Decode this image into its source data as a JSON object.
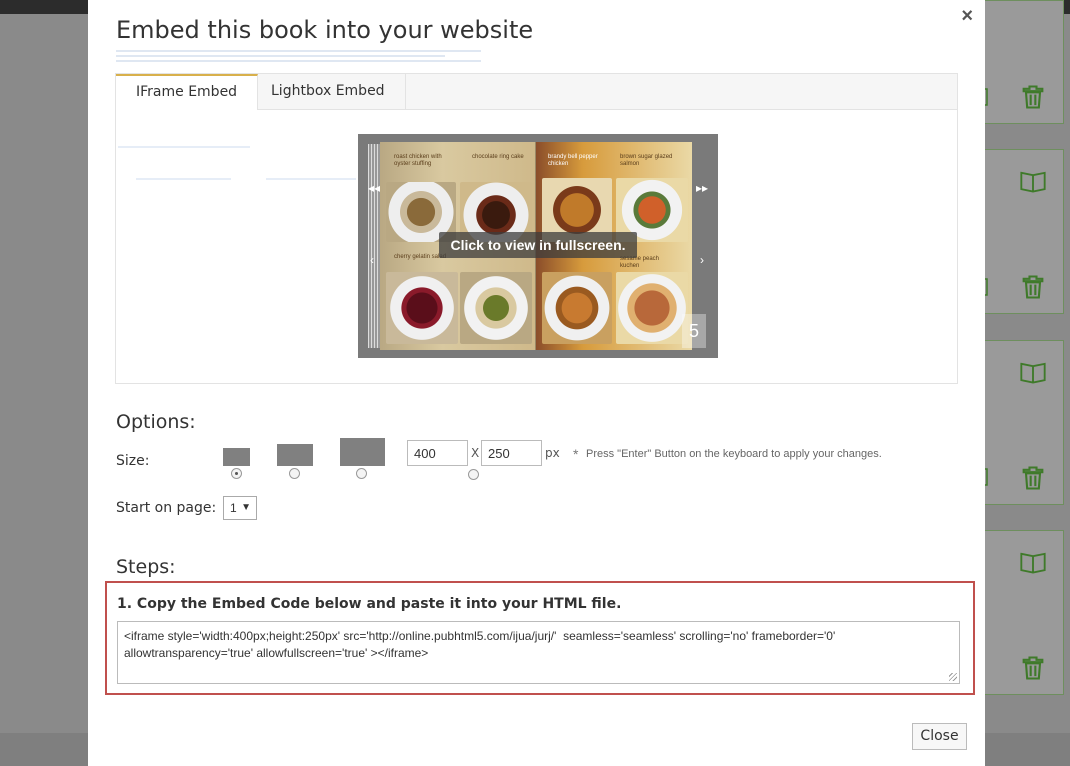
{
  "modal": {
    "title": "Embed this book into your website",
    "close_symbol": "×",
    "tabs": [
      {
        "label": "IFrame Embed",
        "active": true
      },
      {
        "label": "Lightbox Embed",
        "active": false
      }
    ],
    "preview": {
      "overlay_text": "Click to view in fullscreen.",
      "page_number": "5",
      "recipes": [
        "roast chicken with oyster stuffing",
        "chocolate ring cake",
        "brandy bell pepper chicken",
        "brown sugar glazed salmon",
        "cherry gelatin salad",
        "sesame peach kuchen"
      ]
    },
    "options": {
      "title": "Options:",
      "size_label": "Size:",
      "width_value": "400",
      "height_value": "250",
      "separator": "X",
      "unit": "px",
      "hint": "Press \"Enter\" Button on the keyboard to apply your changes.",
      "hint_star": "*",
      "start_page_label": "Start on page:",
      "start_page_value": "1"
    },
    "steps": {
      "title": "Steps:",
      "step1_label": "1. Copy the Embed Code below and paste it into your HTML file.",
      "embed_code": "<iframe style='width:400px;height:250px' src='http://online.pubhtml5.com/ijua/jurj/'  seamless='seamless' scrolling='no' frameborder='0' allowtransparency='true' allowfullscreen='true' ></iframe>"
    },
    "close_button": "Close"
  },
  "colors": {
    "accent_tab": "#d8b04c",
    "highlight_border": "#c0504d",
    "card_border": "#6e8f5e",
    "icon_green": "#3f7a2a"
  }
}
